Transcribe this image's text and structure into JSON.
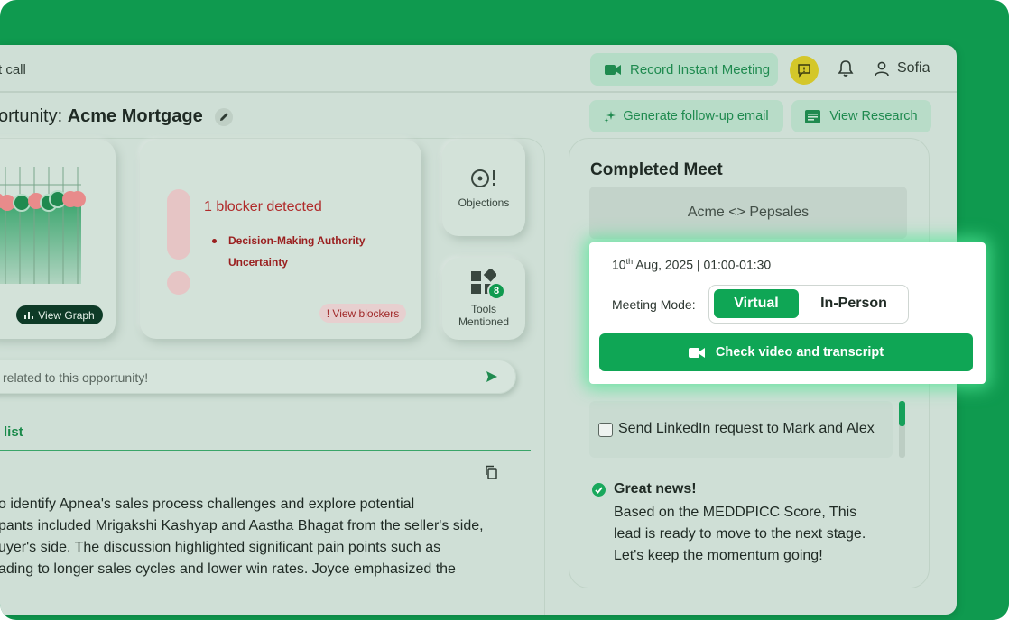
{
  "header": {
    "title_fragment": "t call",
    "record_label": "Record Instant Meeting",
    "user_name": "Sofia"
  },
  "opportunity": {
    "prefix": "ortunity: ",
    "name": "Acme Mortgage",
    "generate_label": "Generate follow-up email",
    "research_label": "View Research"
  },
  "graph_card": {
    "button_label": "View Graph"
  },
  "blockers": {
    "title": "1 blocker detected",
    "items": [
      "Decision-Making Authority Uncertainty"
    ],
    "view_label": "! View blockers"
  },
  "objections": {
    "label": "Objections"
  },
  "tools": {
    "label": "Tools Mentioned",
    "count": "8"
  },
  "ask": {
    "placeholder": "related to this opportunity!"
  },
  "tabs": {
    "active": "list"
  },
  "summary": {
    "lines": [
      "o identify Apnea's sales process challenges and explore potential",
      "pants included Mrigakshi Kashyap and Aastha Bhagat from the seller's side,",
      "uyer's side. The discussion highlighted significant pain points such as",
      "ading to longer sales cycles and lower win rates. Joyce emphasized the"
    ]
  },
  "completed": {
    "title": "Completed Meet",
    "meeting_name": "Acme <> Pepsales",
    "date_day": "10",
    "date_suffix": "th",
    "date_rest": " Aug, 2025 | 01:00-01:30",
    "mode_label": "Meeting Mode:",
    "mode_virtual": "Virtual",
    "mode_inperson": "In-Person",
    "mode_selected": "Virtual",
    "check_label": "Check video and transcript"
  },
  "task": {
    "label": "Send LinkedIn request to Mark and Alex",
    "checked": false
  },
  "news": {
    "title": "Great news!",
    "body": "Based on the MEDDPICC Score, This lead is ready to move to the next stage. Let's keep the momentum going!"
  },
  "colors": {
    "brand": "#0f9a4f",
    "accent": "#0fa655",
    "danger": "#b02a2a"
  }
}
